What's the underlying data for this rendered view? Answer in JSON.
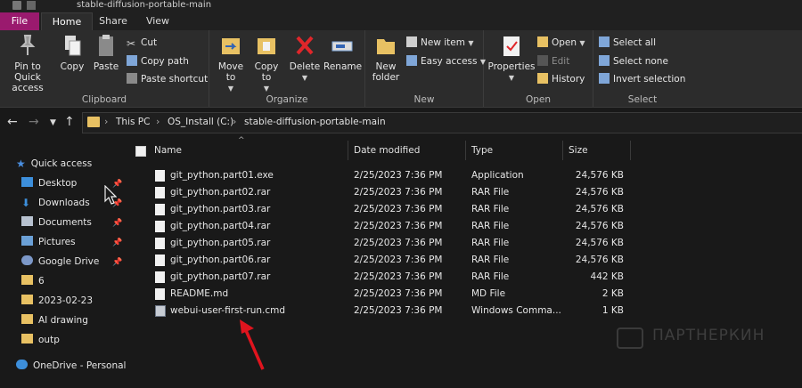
{
  "window": {
    "title": "stable-diffusion-portable-main"
  },
  "tabs": [
    "File",
    "Home",
    "Share",
    "View"
  ],
  "ribbon": {
    "clipboard": {
      "label": "Clipboard",
      "pin": "Pin to Quick access",
      "copy": "Copy",
      "paste": "Paste",
      "cut": "Cut",
      "copy_path": "Copy path",
      "paste_shortcut": "Paste shortcut"
    },
    "organize": {
      "label": "Organize",
      "move_to": "Move to",
      "copy_to": "Copy to",
      "delete": "Delete",
      "rename": "Rename"
    },
    "new": {
      "label": "New",
      "new_folder": "New folder",
      "new_item": "New item",
      "easy_access": "Easy access"
    },
    "open": {
      "label": "Open",
      "properties": "Properties",
      "open": "Open",
      "edit": "Edit",
      "history": "History"
    },
    "select": {
      "label": "Select",
      "select_all": "Select all",
      "select_none": "Select none",
      "invert": "Invert selection"
    }
  },
  "address": {
    "crumbs": [
      "This PC",
      "OS_Install (C:)",
      "stable-diffusion-portable-main"
    ]
  },
  "sidebar": {
    "items": [
      {
        "label": "Quick access"
      },
      {
        "label": "Desktop"
      },
      {
        "label": "Downloads"
      },
      {
        "label": "Documents"
      },
      {
        "label": "Pictures"
      },
      {
        "label": "Google Drive"
      },
      {
        "label": "6"
      },
      {
        "label": "2023-02-23"
      },
      {
        "label": "AI drawing"
      },
      {
        "label": "outp"
      },
      {
        "label": "OneDrive - Personal"
      }
    ]
  },
  "columns": {
    "name": "Name",
    "date": "Date modified",
    "type": "Type",
    "size": "Size"
  },
  "files": [
    {
      "name": "git_python.part01.exe",
      "date": "2/25/2023 7:36 PM",
      "type": "Application",
      "size": "24,576 KB"
    },
    {
      "name": "git_python.part02.rar",
      "date": "2/25/2023 7:36 PM",
      "type": "RAR File",
      "size": "24,576 KB"
    },
    {
      "name": "git_python.part03.rar",
      "date": "2/25/2023 7:36 PM",
      "type": "RAR File",
      "size": "24,576 KB"
    },
    {
      "name": "git_python.part04.rar",
      "date": "2/25/2023 7:36 PM",
      "type": "RAR File",
      "size": "24,576 KB"
    },
    {
      "name": "git_python.part05.rar",
      "date": "2/25/2023 7:36 PM",
      "type": "RAR File",
      "size": "24,576 KB"
    },
    {
      "name": "git_python.part06.rar",
      "date": "2/25/2023 7:36 PM",
      "type": "RAR File",
      "size": "24,576 KB"
    },
    {
      "name": "git_python.part07.rar",
      "date": "2/25/2023 7:36 PM",
      "type": "RAR File",
      "size": "442 KB"
    },
    {
      "name": "README.md",
      "date": "2/25/2023 7:36 PM",
      "type": "MD File",
      "size": "2 KB"
    },
    {
      "name": "webui-user-first-run.cmd",
      "date": "2/25/2023 7:36 PM",
      "type": "Windows Comma...",
      "size": "1 KB"
    }
  ],
  "watermark": "ПАРТНЕРКИН",
  "colors": {
    "file_tab": "#9a1a6e",
    "folder": "#e8c163",
    "arrow": "#e0141e"
  }
}
